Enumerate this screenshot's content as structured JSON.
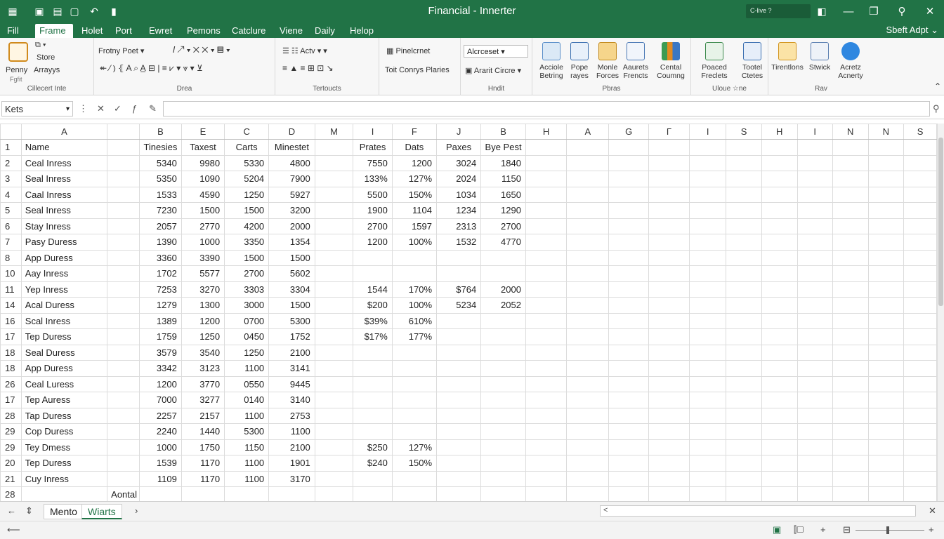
{
  "window": {
    "title": "Financial - Innerter",
    "search": "C-live ?",
    "colors": {
      "brand": "#217346",
      "ribbon_bg": "#f7f7f7"
    }
  },
  "menu": {
    "items": [
      "Fill",
      "Frame",
      "Holet",
      "Port",
      "Ewret",
      "Pemons",
      "Catclure",
      "Viene",
      "Daily",
      "Helop"
    ],
    "active_index": 1,
    "right_label": "Sbeft Adpt ⌄"
  },
  "ribbon": {
    "clipboard": {
      "label1": "Penny",
      "label2": "Arrayys",
      "sub": "Fgfit",
      "store": "Store",
      "group": "Cillecert Inte"
    },
    "font": {
      "font_name": "Frotny Poet",
      "group": "Drea"
    },
    "align": {
      "a1": "Actv",
      "group": "Tertoucts"
    },
    "number": {
      "label1": "Pinelcrnet",
      "label2": "Toit Conrys Plaries",
      "group": ""
    },
    "styles": {
      "dropdown": "Alcrceset",
      "label2": "Ararit Circre",
      "group": "Hndit"
    },
    "big_buttons": [
      {
        "label1": "Acciole",
        "label2": "Betring",
        "icon": "picture-icon"
      },
      {
        "label1": "Pope",
        "label2": "rayes",
        "icon": "table-icon"
      },
      {
        "label1": "Monle",
        "label2": "Forces",
        "icon": "shapes-icon"
      },
      {
        "label1": "Aaurets",
        "label2": "Frencts",
        "icon": "doc-search-icon"
      },
      {
        "label1": "Cental",
        "label2": "Coumng",
        "icon": "chart-icon"
      },
      {
        "label1": "Poaced",
        "label2": "Freclets",
        "icon": "monitor-icon"
      },
      {
        "label1": "Tootel",
        "label2": "Ctetes",
        "icon": "screen-icon"
      },
      {
        "label1": "Tirentlons",
        "label2": "",
        "icon": "arrow-up-icon"
      },
      {
        "label1": "Stwick",
        "label2": "",
        "icon": "link-icon"
      },
      {
        "label1": "Acretz",
        "label2": "Acnerty",
        "icon": "circle-icon"
      }
    ],
    "group_labels": {
      "g_a": "Pbras",
      "g_b": "Uloue ☆ne",
      "g_c": "Rav"
    }
  },
  "formula_bar": {
    "name_box": "Kets",
    "formula": ""
  },
  "sheet": {
    "columns": [
      "A",
      "",
      "B",
      "E",
      "C",
      "D",
      "M",
      "I",
      "F",
      "J",
      "B",
      "H",
      "A",
      "G",
      "Γ",
      "I",
      "S",
      "H",
      "I",
      "N",
      "N",
      "S"
    ],
    "rows": [
      {
        "num": "1",
        "cells": [
          "Name",
          "",
          "Tinesies",
          "Taxest",
          "Carts",
          "Minestet",
          "",
          "Prates",
          "Dats",
          "Paxes",
          "Bye Pest"
        ]
      },
      {
        "num": "2",
        "cells": [
          "Ceal   Inress",
          "",
          "5340",
          "9980",
          "5330",
          "4800",
          "",
          "7550",
          "1200",
          "3024",
          "1840"
        ]
      },
      {
        "num": "3",
        "cells": [
          "Seal   Inress",
          "",
          "5350",
          "1090",
          "5204",
          "7900",
          "",
          "133%",
          "127%",
          "2024",
          "1150"
        ]
      },
      {
        "num": "4",
        "cells": [
          "Caal   Inress",
          "",
          "1533",
          "4590",
          "1250",
          "5927",
          "",
          "5500",
          "150%",
          "1034",
          "1650"
        ]
      },
      {
        "num": "5",
        "cells": [
          "Seal   Inress",
          "",
          "7230",
          "1500",
          "1500",
          "3200",
          "",
          "1900",
          "1104",
          "1234",
          "1290"
        ]
      },
      {
        "num": "6",
        "cells": [
          "Stay   Inress",
          "",
          "2057",
          "2770",
          "4200",
          "2000",
          "",
          "2700",
          "1597",
          "2313",
          "2700"
        ]
      },
      {
        "num": "7",
        "cells": [
          "Pasy   Duress",
          "",
          "1390",
          "1000",
          "3350",
          "1354",
          "",
          "1200",
          "100%",
          "1532",
          "4770"
        ]
      },
      {
        "num": "8",
        "cells": [
          "App   Duress",
          "",
          "3360",
          "3390",
          "1500",
          "1500",
          "",
          "",
          "",
          "",
          ""
        ]
      },
      {
        "num": "10",
        "cells": [
          "Aay   Inress",
          "",
          "1702",
          "5577",
          "2700",
          "5602",
          "",
          "",
          "",
          "",
          ""
        ]
      },
      {
        "num": "11",
        "cells": [
          "Yep   Inress",
          "",
          "7253",
          "3270",
          "3303",
          "3304",
          "",
          "1544",
          "170%",
          "$764",
          "2000"
        ]
      },
      {
        "num": "14",
        "cells": [
          "Acal   Duress",
          "",
          "1279",
          "1300",
          "3000",
          "1500",
          "",
          "$200",
          "100%",
          "5234",
          "2052"
        ]
      },
      {
        "num": "16",
        "cells": [
          "Scal   Inress",
          "",
          "1389",
          "1200",
          "0700",
          "5300",
          "",
          "$39%",
          "610%",
          "",
          ""
        ]
      },
      {
        "num": "17",
        "cells": [
          "Tep   Duress",
          "",
          "1759",
          "1250",
          "0450",
          "1752",
          "",
          "$17%",
          "177%",
          "",
          ""
        ]
      },
      {
        "num": "18",
        "cells": [
          "Seal   Duress",
          "",
          "3579",
          "3540",
          "1250",
          "2100",
          "",
          "",
          "",
          "",
          ""
        ]
      },
      {
        "num": "18",
        "cells": [
          "App   Duress",
          "",
          "3342",
          "3123",
          "1100",
          "3141",
          "",
          "",
          "",
          "",
          ""
        ]
      },
      {
        "num": "26",
        "cells": [
          "Ceal   Luress",
          "",
          "1200",
          "3770",
          "0550",
          "9445",
          "",
          "",
          "",
          "",
          ""
        ]
      },
      {
        "num": "17",
        "cells": [
          "Tep   Auress",
          "",
          "7000",
          "3277",
          "0140",
          "3140",
          "",
          "",
          "",
          "",
          ""
        ]
      },
      {
        "num": "28",
        "cells": [
          "Tap   Duress",
          "",
          "2257",
          "2157",
          "1100",
          "2753",
          "",
          "",
          "",
          "",
          ""
        ]
      },
      {
        "num": "29",
        "cells": [
          "Cop   Duress",
          "",
          "2240",
          "1440",
          "5300",
          "1100",
          "",
          "",
          "",
          "",
          ""
        ]
      },
      {
        "num": "29",
        "cells": [
          "Tey   Dmess",
          "",
          "1000",
          "1750",
          "1150",
          "2100",
          "",
          "$250",
          "127%",
          "",
          ""
        ]
      },
      {
        "num": "20",
        "cells": [
          "Tep   Duress",
          "",
          "1539",
          "1170",
          "1100",
          "1901",
          "",
          "$240",
          "150%",
          "",
          ""
        ]
      },
      {
        "num": "21",
        "cells": [
          "Cuy   Inress",
          "",
          "1109",
          "1170",
          "1100",
          "3170",
          "",
          "",
          "",
          "",
          ""
        ]
      },
      {
        "num": "28",
        "cells": [
          "",
          "Aontal",
          "",
          "",
          "",
          "",
          "",
          "",
          "",
          "",
          ""
        ]
      }
    ]
  },
  "tabs": {
    "items": [
      "Mento",
      "Wiarts"
    ],
    "active_index": 1,
    "scroll_label": "<"
  },
  "status": {
    "left": "⟵"
  }
}
